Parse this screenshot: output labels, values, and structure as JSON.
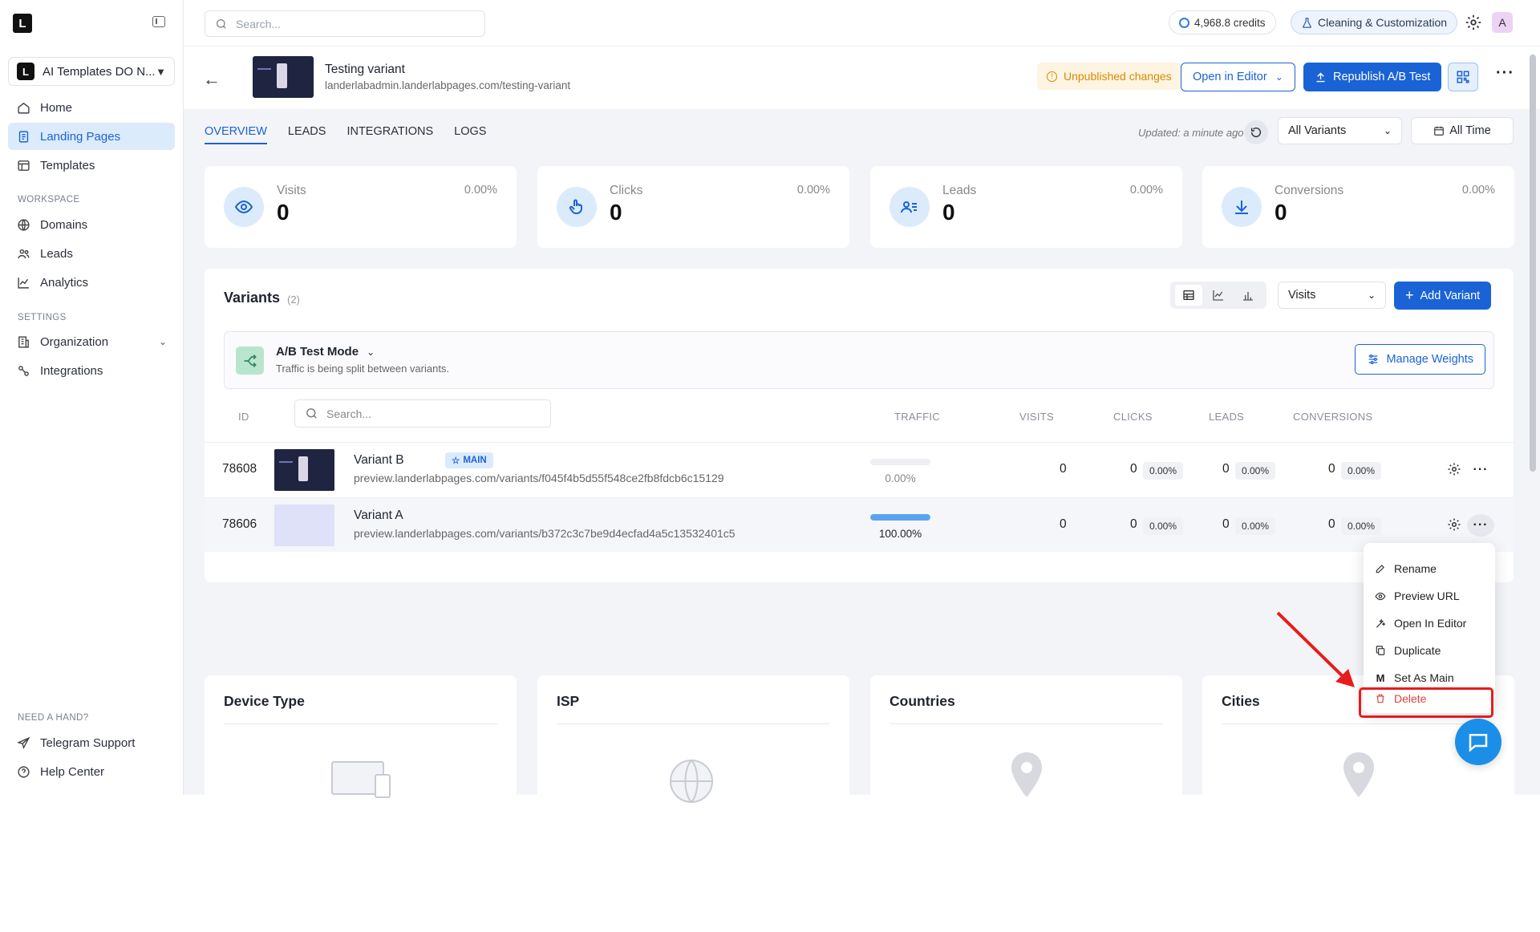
{
  "app": {
    "logo_letter": "L"
  },
  "sidebar": {
    "workspace": {
      "logo_letter": "L",
      "name": "AI Templates DO N..."
    },
    "items": [
      {
        "label": "Home"
      },
      {
        "label": "Landing Pages"
      },
      {
        "label": "Templates"
      }
    ],
    "workspace_label": "WORKSPACE",
    "workspace_items": [
      {
        "label": "Domains"
      },
      {
        "label": "Leads"
      },
      {
        "label": "Analytics"
      }
    ],
    "settings_label": "SETTINGS",
    "settings_items": [
      {
        "label": "Organization"
      },
      {
        "label": "Integrations"
      }
    ],
    "help_label": "NEED A HAND?",
    "help_items": [
      {
        "label": "Telegram Support"
      },
      {
        "label": "Help Center"
      }
    ]
  },
  "topbar": {
    "search_placeholder": "Search...",
    "credits": "4,968.8 credits",
    "cleaning": "Cleaning & Customization",
    "avatar_letter": "A"
  },
  "page": {
    "title": "Testing variant",
    "url": "landerlabadmin.landerlabpages.com/testing-variant",
    "unpublished": "Unpublished changes",
    "open_editor": "Open in Editor",
    "republish": "Republish A/B Test"
  },
  "tabs": [
    {
      "label": "OVERVIEW"
    },
    {
      "label": "LEADS"
    },
    {
      "label": "INTEGRATIONS"
    },
    {
      "label": "LOGS"
    }
  ],
  "filters": {
    "updated": "Updated: a minute ago",
    "variants_select": "All Variants",
    "time": "All Time"
  },
  "stats": [
    {
      "label": "Visits",
      "value": "0",
      "pct": "0.00%"
    },
    {
      "label": "Clicks",
      "value": "0",
      "pct": "0.00%"
    },
    {
      "label": "Leads",
      "value": "0",
      "pct": "0.00%"
    },
    {
      "label": "Conversions",
      "value": "0",
      "pct": "0.00%"
    }
  ],
  "variants": {
    "title": "Variants",
    "count": "(2)",
    "metric_select": "Visits",
    "add_button": "Add Variant",
    "ab_title": "A/B Test Mode",
    "ab_sub": "Traffic is being split between variants.",
    "manage_weights": "Manage Weights",
    "search_placeholder": "Search...",
    "columns": {
      "id": "ID",
      "traffic": "TRAFFIC",
      "visits": "VISITS",
      "clicks": "CLICKS",
      "leads": "LEADS",
      "conversions": "CONVERSIONS"
    },
    "rows": [
      {
        "id": "78608",
        "name": "Variant B",
        "badge": "MAIN",
        "url": "preview.landerlabpages.com/variants/f045f4b5d55f548ce2fb8fdcb6c15129",
        "traffic": "0.00%",
        "traffic_fraction": 0,
        "visits": "0",
        "clicks": "0",
        "clicks_pct": "0.00%",
        "leads": "0",
        "leads_pct": "0.00%",
        "conversions": "0",
        "conversions_pct": "0.00%"
      },
      {
        "id": "78606",
        "name": "Variant A",
        "badge": "",
        "url": "preview.landerlabpages.com/variants/b372c3c7be9d4ecfad4a5c13532401c5",
        "traffic": "100.00%",
        "traffic_fraction": 1,
        "visits": "0",
        "clicks": "0",
        "clicks_pct": "0.00%",
        "leads": "0",
        "leads_pct": "0.00%",
        "conversions": "0",
        "conversions_pct": "0.00%"
      }
    ]
  },
  "cards": [
    {
      "title": "Device Type"
    },
    {
      "title": "ISP"
    },
    {
      "title": "Countries"
    },
    {
      "title": "Cities"
    }
  ],
  "context_menu": {
    "items": [
      {
        "label": "Rename",
        "icon": "pencil-icon"
      },
      {
        "label": "Preview URL",
        "icon": "eye-icon"
      },
      {
        "label": "Open In Editor",
        "icon": "wand-icon"
      },
      {
        "label": "Duplicate",
        "icon": "copy-icon"
      },
      {
        "label": "Set As Main",
        "icon": "m-icon",
        "glyph": "M"
      },
      {
        "label": "Delete",
        "icon": "trash-icon"
      }
    ]
  },
  "colors": {
    "accent": "#1a63d6",
    "delete": "#e0413b",
    "annotation": "#e81c1c"
  }
}
